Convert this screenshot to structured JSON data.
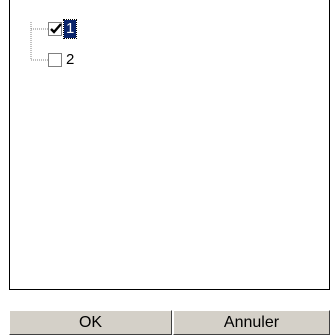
{
  "tree": {
    "items": [
      {
        "label": "1",
        "checked": true,
        "selected": true
      },
      {
        "label": "2",
        "checked": false,
        "selected": false
      }
    ]
  },
  "buttons": {
    "ok_label": "OK",
    "cancel_label": "Annuler"
  },
  "colors": {
    "selection_bg": "#0a246a",
    "button_face": "#d4d0c8"
  }
}
